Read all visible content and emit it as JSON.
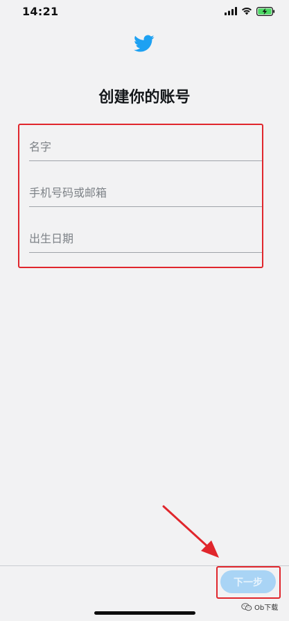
{
  "status_bar": {
    "time": "14:21",
    "icons": [
      "cellular-signal-icon",
      "wifi-icon",
      "battery-charging-icon"
    ],
    "battery_color": "#4cd964"
  },
  "header": {
    "logo_icon": "twitter-bird-icon",
    "logo_color": "#1da1f2",
    "title": "创建你的账号"
  },
  "form": {
    "name": {
      "placeholder": "名字",
      "value": ""
    },
    "phone_or_email": {
      "placeholder": "手机号码或邮箱",
      "value": ""
    },
    "birth_date": {
      "placeholder": "出生日期",
      "value": ""
    }
  },
  "footer": {
    "next_label": "下一步",
    "next_button_color": "#a9d4f5"
  },
  "annotations": {
    "highlight_color": "#e0262c"
  },
  "watermark": {
    "text": "Ob下载",
    "icon": "wechat-icon"
  }
}
